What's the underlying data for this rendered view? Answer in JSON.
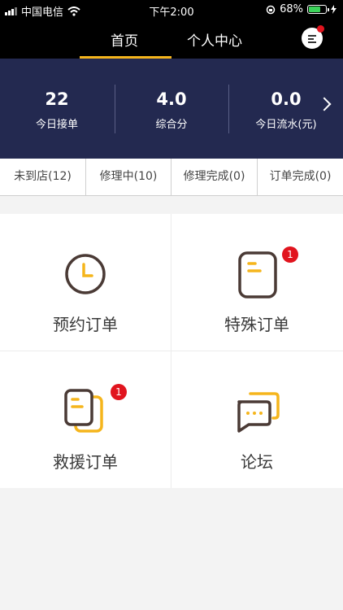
{
  "status_bar": {
    "carrier": "中国电信",
    "time": "下午2:00",
    "battery": "68%",
    "battery_level": 0.68
  },
  "nav": {
    "tabs": [
      "首页",
      "个人中心"
    ],
    "active_tab": "首页"
  },
  "stats": [
    {
      "value": "22",
      "label": "今日接单"
    },
    {
      "value": "4.0",
      "label": "综合分"
    },
    {
      "value": "0.0",
      "label": "今日流水(元)"
    }
  ],
  "filters": [
    "未到店(12)",
    "修理中(10)",
    "修理完成(0)",
    "订单完成(0)"
  ],
  "grid": [
    {
      "label": "预约订单",
      "icon": "clock-icon",
      "badge": ""
    },
    {
      "label": "特殊订单",
      "icon": "document-icon",
      "badge": "1"
    },
    {
      "label": "救援订单",
      "icon": "documents-icon",
      "badge": "1"
    },
    {
      "label": "论坛",
      "icon": "chat-bubbles-icon",
      "badge": ""
    }
  ],
  "colors": {
    "accent": "#f5b51c",
    "header_bg": "#232950",
    "icon_stroke": "#4a3a35",
    "badge": "#e1141e"
  }
}
